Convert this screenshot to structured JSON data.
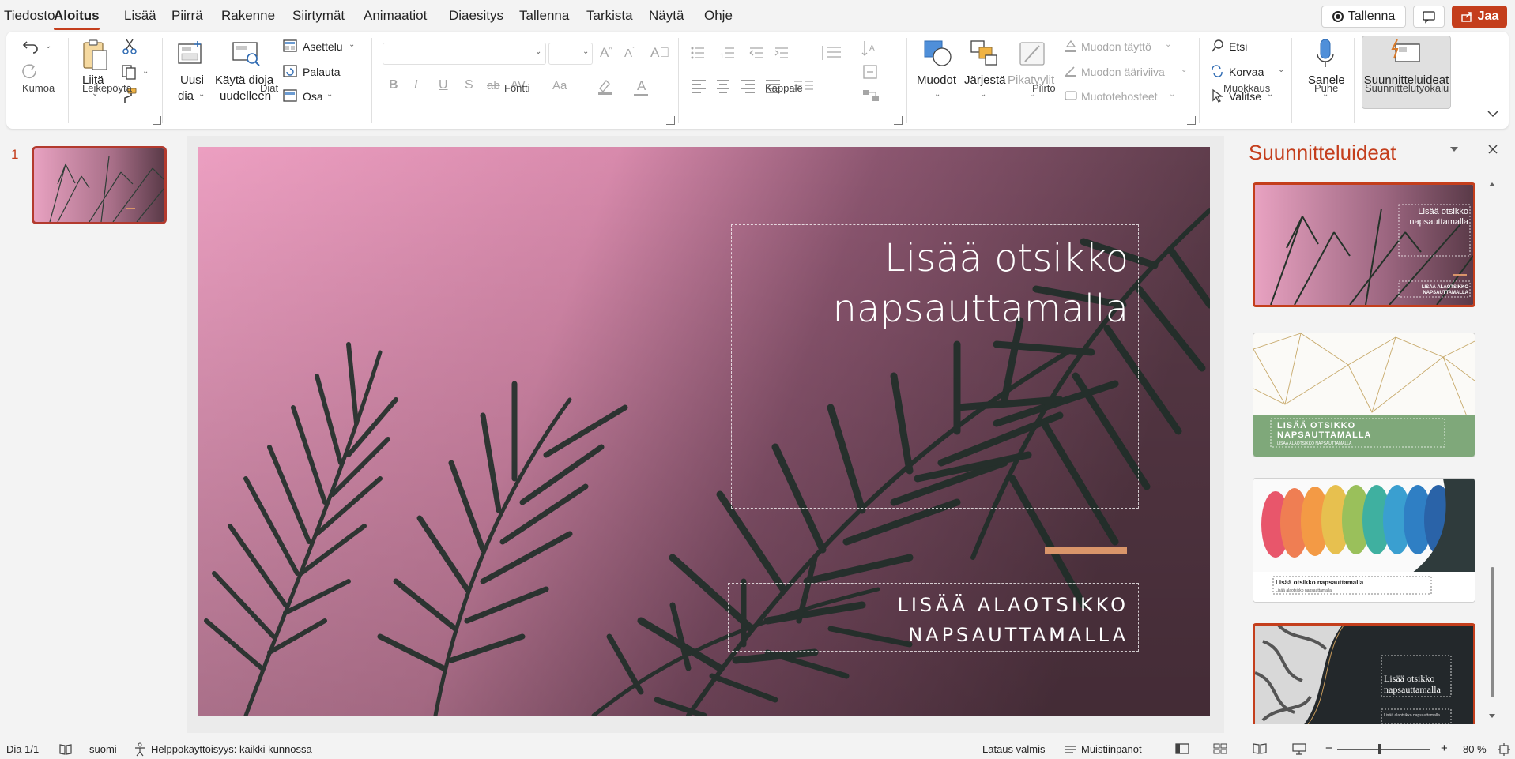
{
  "menu": {
    "tabs": [
      "Tiedosto",
      "Aloitus",
      "Lisää",
      "Piirrä",
      "Rakenne",
      "Siirtymät",
      "Animaatiot",
      "Diaesitys",
      "Tallenna",
      "Tarkista",
      "Näytä",
      "Ohje"
    ],
    "active_tab": "Aloitus",
    "record_label": "Tallenna",
    "share_label": "Jaa"
  },
  "ribbon": {
    "groups": {
      "kumoa": "Kumoa",
      "leikepoyta": "Leikepöytä",
      "diat": "Diat",
      "fontti": "Fontti",
      "kappale": "Kappale",
      "piirto": "Piirto",
      "muokkaus": "Muokkaus",
      "puhe": "Puhe",
      "suunnittelu": "Suunnittelutyökalu"
    },
    "paste": "Liitä",
    "new_slide_1": "Uusi",
    "new_slide_2": "dia",
    "reuse_1": "Käytä dioja",
    "reuse_2": "uudelleen",
    "layout": "Asettelu",
    "reset": "Palauta",
    "section": "Osa",
    "font_buttons": [
      "B",
      "I",
      "U",
      "S",
      "ab",
      "AV",
      "Aa"
    ],
    "shapes": "Muodot",
    "arrange": "Järjestä",
    "quick_styles": "Pikatyylit",
    "shape_fill": "Muodon täyttö",
    "shape_outline": "Muodon ääriviiva",
    "shape_effects": "Muototehosteet",
    "find": "Etsi",
    "replace": "Korvaa",
    "select": "Valitse",
    "dictate": "Sanele",
    "designer": "Suunnitteluideat"
  },
  "thumbnails": [
    {
      "number": "1"
    }
  ],
  "slide": {
    "title_line1": "Lisää otsikko",
    "title_line2": "napsauttamalla",
    "subtitle_line1": "LISÄÄ ALAOTSIKKO",
    "subtitle_line2": "NAPSAUTTAMALLA"
  },
  "designer": {
    "title": "Suunnitteluideat",
    "ideas": [
      {
        "title": "Lisää otsikko napsauttamalla",
        "subtitle": "LISÄÄ ALAOTSIKKO NAPSAUTTAMALLA"
      },
      {
        "title": "LISÄÄ OTSIKKO NAPSAUTTAMALLA",
        "subtitle": "LISÄÄ ALAOTSIKKO NAPSAUTTAMALLA"
      },
      {
        "title": "Lisää otsikko napsauttamalla",
        "subtitle": "Lisää alaotsikko napsauttamalla"
      },
      {
        "title": "Lisää otsikko napsauttamalla",
        "subtitle": "Lisää alaotsikko napsauttamalla"
      }
    ]
  },
  "status": {
    "slide_info": "Dia 1/1",
    "language": "suomi",
    "accessibility": "Helppokäyttöisyys: kaikki kunnossa",
    "loading": "Lataus valmis",
    "notes": "Muistiinpanot",
    "zoom": "80 %"
  },
  "colors": {
    "accent": "#c43e1c",
    "slide_pink": "#e59ab9",
    "slide_bar": "#d9956a"
  }
}
